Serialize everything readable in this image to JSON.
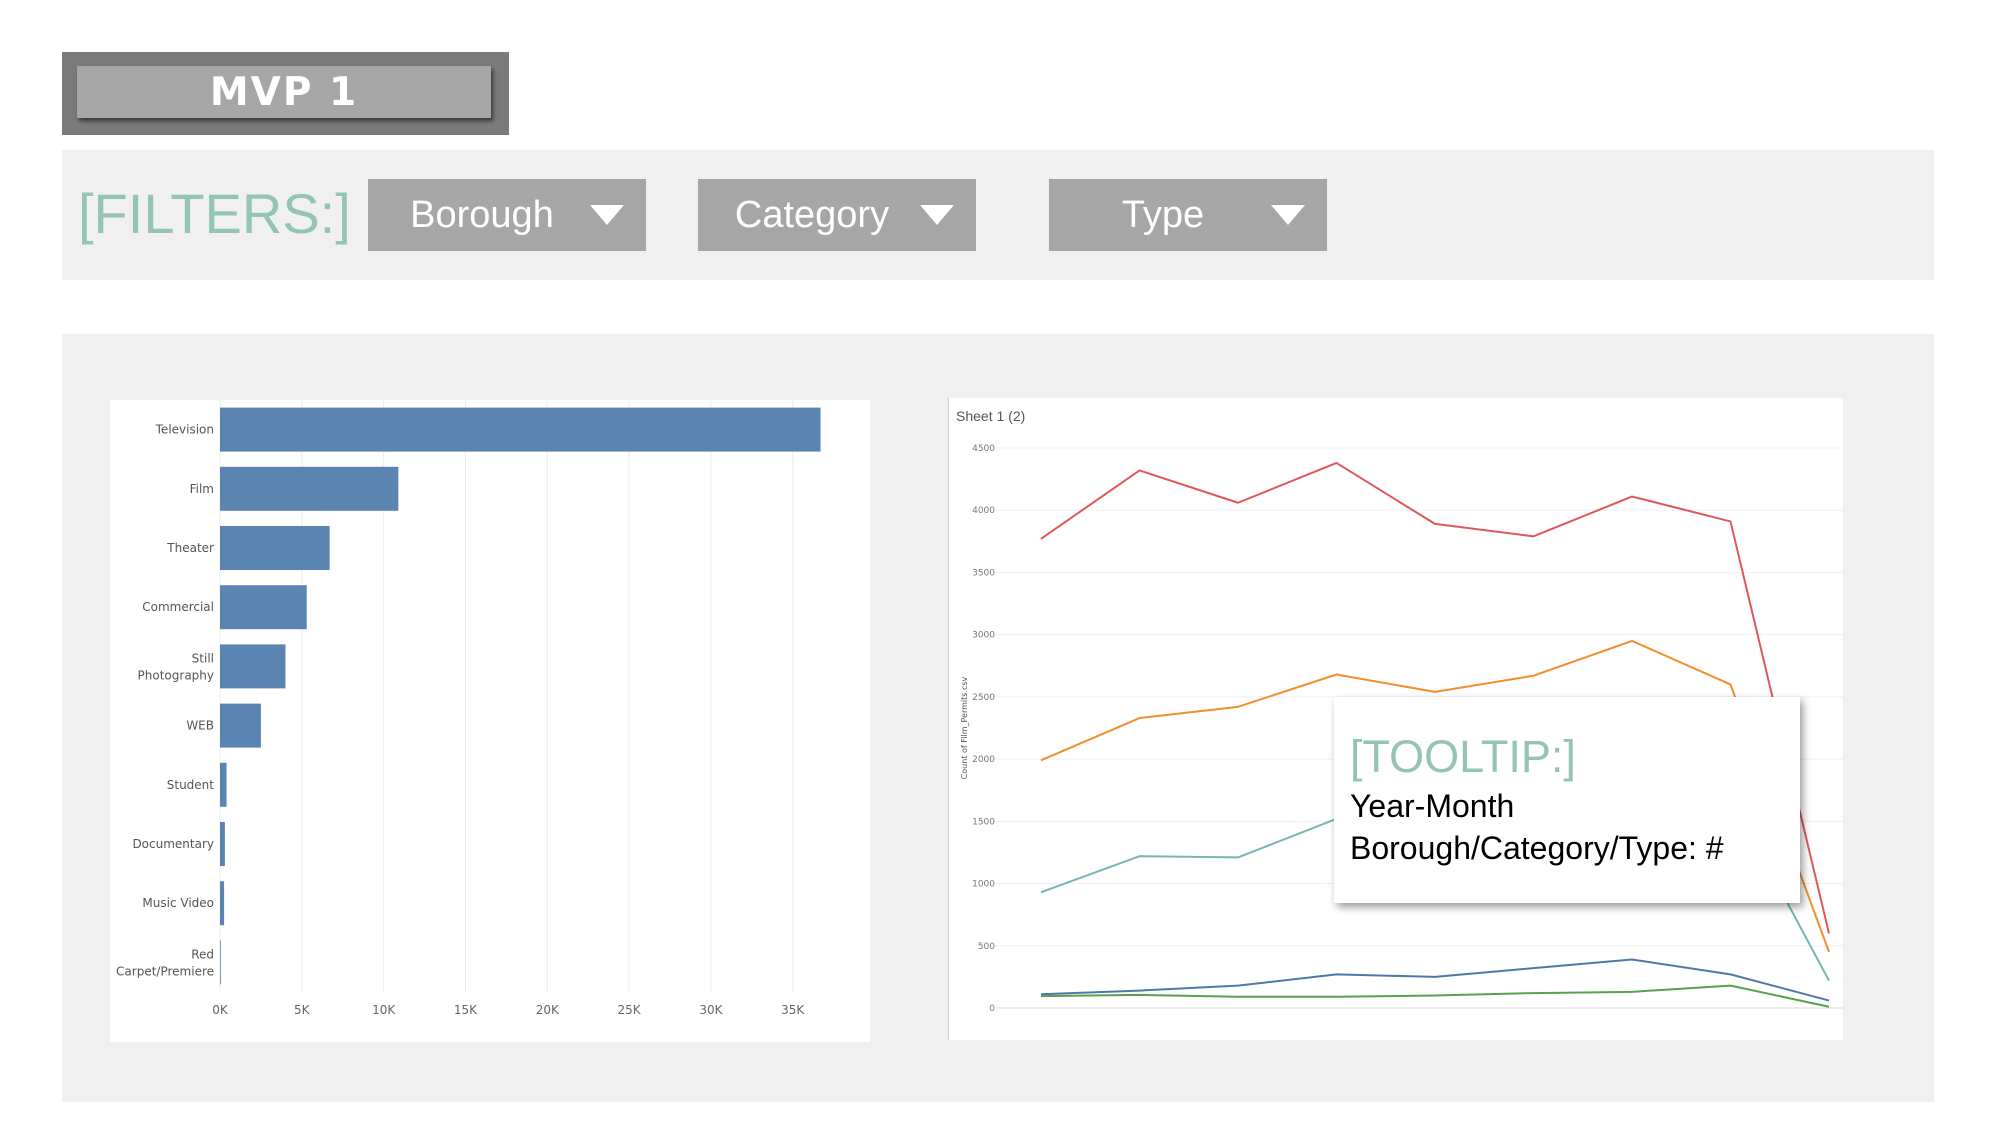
{
  "banner": {
    "title": "MVP 1"
  },
  "filters": {
    "label": "[FILTERS:]",
    "dropdowns": [
      {
        "label": "Borough"
      },
      {
        "label": "Category"
      },
      {
        "label": "Type"
      }
    ]
  },
  "tooltip": {
    "title": "[TOOLTIP:]",
    "line1": "Year-Month",
    "line2": "Borough/Category/Type: #"
  },
  "chart_data": [
    {
      "type": "bar",
      "orientation": "horizontal",
      "categories": [
        "Television",
        "Film",
        "Theater",
        "Commercial",
        "Still Photography",
        "WEB",
        "Student",
        "Documentary",
        "Music Video",
        "Red Carpet/Premiere"
      ],
      "values": [
        36700,
        10900,
        6700,
        5300,
        4000,
        2500,
        400,
        300,
        250,
        50
      ],
      "xlim": [
        0,
        38500
      ],
      "xticks": [
        "0K",
        "5K",
        "10K",
        "15K",
        "20K",
        "25K",
        "30K",
        "35K"
      ],
      "grid": true,
      "color": "#5b84b1"
    },
    {
      "type": "line",
      "title": "Sheet 1 (2)",
      "ylabel": "Count of Film_Permits.csv",
      "ylim": [
        0,
        4500
      ],
      "yticks": [
        "0",
        "500",
        "1000",
        "1500",
        "2000",
        "2500",
        "3000",
        "3500",
        "4000",
        "4500"
      ],
      "x": [
        1,
        2,
        3,
        4,
        5,
        6,
        7,
        8,
        9
      ],
      "series": [
        {
          "color": "#e15759",
          "values": [
            3770,
            4320,
            4060,
            4380,
            3890,
            3790,
            4110,
            3910,
            600
          ]
        },
        {
          "color": "#f28e2b",
          "values": [
            1990,
            2330,
            2420,
            2680,
            2540,
            2670,
            2950,
            2600,
            450
          ]
        },
        {
          "color": "#76b7b2",
          "values": [
            930,
            1220,
            1210,
            1520,
            1800,
            1900,
            1950,
            1700,
            220
          ]
        },
        {
          "color": "#4e79a7",
          "values": [
            110,
            140,
            180,
            270,
            250,
            320,
            390,
            270,
            60
          ]
        },
        {
          "color": "#59a14f",
          "values": [
            95,
            105,
            90,
            90,
            100,
            120,
            130,
            180,
            10
          ]
        }
      ]
    }
  ]
}
